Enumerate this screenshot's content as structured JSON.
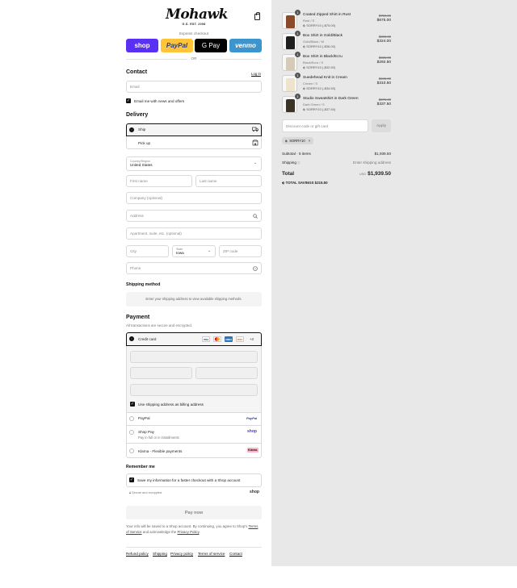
{
  "brand": {
    "logo_text": "Mohawk",
    "tagline": "G.S. EST. 2008"
  },
  "express": {
    "label": "Express checkout",
    "buttons": [
      {
        "label": "shop",
        "bg": "#5a31f4",
        "color": "#ffffff"
      },
      {
        "label": "PayPal",
        "bg": "#ffc439",
        "color": "#253b80"
      },
      {
        "label": "G Pay",
        "bg": "#000000",
        "color": "#ffffff"
      },
      {
        "label": "venmo",
        "bg": "#3d95ce",
        "color": "#ffffff"
      }
    ],
    "or_label": "OR"
  },
  "contact": {
    "heading": "Contact",
    "login_link": "Log in",
    "email_placeholder": "Email",
    "newsletter_label": "Email me with news and offers"
  },
  "delivery": {
    "heading": "Delivery",
    "options": [
      {
        "label": "Ship",
        "icon": "truck-icon"
      },
      {
        "label": "Pick up",
        "icon": "store-icon"
      }
    ],
    "country_label": "Country/Region",
    "country_value": "United States",
    "first_name": "First name",
    "last_name": "Last name",
    "company": "Company (optional)",
    "address": "Address",
    "apartment": "Apartment, suite, etc. (optional)",
    "city": "City",
    "state_label": "State",
    "state_value": "Iowa",
    "zip": "ZIP code",
    "phone": "Phone"
  },
  "shipping_method": {
    "heading": "Shipping method",
    "placeholder": "Enter your shipping address to view available shipping methods."
  },
  "payment": {
    "heading": "Payment",
    "subtext": "All transactions are secure and encrypted.",
    "credit_card_label": "Credit card",
    "cards": [
      {
        "label": "VISA",
        "bg": "#ffffff",
        "color": "#1a1f71"
      },
      {
        "label": "MC",
        "bg": "#ffffff",
        "color": "#eb001b"
      },
      {
        "label": "AMEX",
        "bg": "#2e77bc",
        "color": "#ffffff"
      },
      {
        "label": "DISC",
        "bg": "#ffffff",
        "color": "#e65c00"
      }
    ],
    "more_cards": "+4",
    "billing_label": "Use shipping address as billing address",
    "paypal_label": "PayPal",
    "paypal_logo": "PayPal",
    "shoppay_label": "Shop Pay",
    "shoppay_sub": "Pay in full or in installments",
    "shoppay_logo": "shop",
    "klarna_label": "Klarna - Flexible payments",
    "klarna_logo": "Klarna."
  },
  "remember": {
    "heading": "Remember me",
    "save_label": "Save my information for a faster checkout with a Shop account",
    "secure_label": "Secure and encrypted",
    "shop_logo": "shop"
  },
  "pay_now_label": "Pay now",
  "legal": {
    "text_before": "Your info will be saved to a Shop account. By continuing, you agree to Shop's ",
    "terms": "Terms of Service",
    "text_mid": " and acknowledge the ",
    "privacy": "Privacy Policy",
    "text_end": "."
  },
  "footer_links": [
    "Refund policy",
    "Shipping",
    "Privacy policy",
    "Terms of service",
    "Contact"
  ],
  "cart": {
    "items": [
      {
        "qty": "1",
        "name": "Coated Zipped Shirt in Rust",
        "variant": "Rust / S",
        "discount": "SORRY10 (-$75.00)",
        "old_price": "$750.00",
        "price": "$675.00",
        "color": "#8a4a2c"
      },
      {
        "qty": "1",
        "name": "Box Shirt in Gold/Black",
        "variant": "Gold/Black / M",
        "discount": "SORRY10 (-$36.00)",
        "old_price": "$360.00",
        "price": "$324.00",
        "color": "#1f1f1f"
      },
      {
        "qty": "1",
        "name": "Box Shirt in Black/Ecru",
        "variant": "Black/Ecru / S",
        "discount": "SORRY10 (-$32.50)",
        "old_price": "$325.00",
        "price": "$292.50",
        "color": "#d6cbb8"
      },
      {
        "qty": "1",
        "name": "Suedehead Knit in Cream",
        "variant": "Cream / S",
        "discount": "SORRY10 (-$34.50)",
        "old_price": "$345.00",
        "price": "$310.50",
        "color": "#eee3cc"
      },
      {
        "qty": "1",
        "name": "Studio Sweatshirt in Dark Green",
        "variant": "Dark Green / S",
        "discount": "SORRY10 (-$37.50)",
        "old_price": "$375.00",
        "price": "$337.50",
        "color": "#3b3326"
      }
    ],
    "discount_placeholder": "Discount code or gift card",
    "apply_label": "Apply",
    "applied_code": "SORRY10",
    "subtotal_label": "Subtotal · 5 items",
    "subtotal_value": "$1,939.50",
    "shipping_label": "Shipping",
    "shipping_value": "Enter shipping address",
    "total_label": "Total",
    "currency": "USD",
    "total_value": "$1,939.50",
    "savings_label": "TOTAL SAVINGS",
    "savings_value": "$215.50"
  }
}
